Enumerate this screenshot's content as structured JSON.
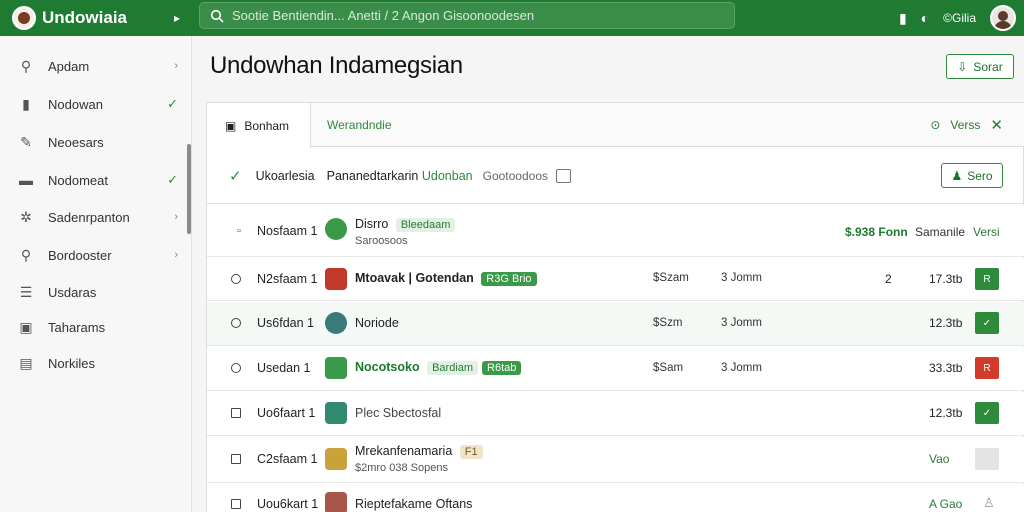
{
  "app": {
    "name": "Undowiaia"
  },
  "search": {
    "placeholder": "Sootie Bentiendin... Anetti / 2 Angon Gisoonoodesen"
  },
  "topbar": {
    "user": "©Gilia"
  },
  "sidebar": {
    "items": [
      {
        "label": "Apdam",
        "icon": "search-icon",
        "trail": "›"
      },
      {
        "label": "Nodowan",
        "icon": "bag-icon",
        "trail": "✓"
      },
      {
        "label": "Neoesars",
        "icon": "pencil-icon",
        "trail": ""
      },
      {
        "label": "Nodomeat",
        "icon": "folder-icon",
        "trail": "✓"
      },
      {
        "label": "Sadenrpanton",
        "icon": "gear-icon",
        "trail": "›"
      },
      {
        "label": "Bordooster",
        "icon": "search-icon",
        "trail": "›"
      },
      {
        "label": "Usdaras",
        "icon": "list-icon",
        "trail": ""
      },
      {
        "label": "Taharams",
        "icon": "image-icon",
        "trail": ""
      },
      {
        "label": "Norkiles",
        "icon": "doc-icon",
        "trail": ""
      }
    ]
  },
  "main": {
    "title": "Undowhan Indamegsian",
    "top_button": "Sorar"
  },
  "tabs": {
    "active": "Bonham",
    "second": "Werandndie",
    "right_label": "Verss"
  },
  "filterbar": {
    "t1": "Ukoarlesia",
    "t2a": "Pananedtarkarin",
    "t2b": "Udonban",
    "t3": "Gootoodoos",
    "button": "Sero"
  },
  "header_row": {
    "name": "Nosfaam 1",
    "title": "Disrro",
    "pill": "Bleedaam",
    "sub": "Saroosoos",
    "price": "$.938 Fonn",
    "col_a": "Samanile",
    "col_b": "Versi"
  },
  "rows": [
    {
      "name": "N2sfaam 1",
      "title": "Mtoavak | Gotendan",
      "pill": "R3G Brio",
      "c1": "$Szam",
      "c2": "3 Jomm",
      "c3": "2",
      "c4": "17.3tb",
      "action": "R",
      "thumb_color": "#c0392b",
      "select": "radio",
      "action_color": "#2e8b3c"
    },
    {
      "name": "Us6fdan 1",
      "title": "Noriode",
      "pill": "",
      "c1": "$Szm",
      "c2": "3 Jomm",
      "c3": "",
      "c4": "12.3tb",
      "action": "✓",
      "thumb_color": "#3a7a7a",
      "select": "radio",
      "action_color": "#2e8b3c"
    },
    {
      "name": "Usedan 1",
      "title": "Nocotsoko",
      "pill": "Bardiam",
      "pill2": "R6tab",
      "c1": "$Sam",
      "c2": "3 Jomm",
      "c3": "",
      "c4": "33.3tb",
      "action": "R",
      "thumb_color": "#3a9a47",
      "select": "radio",
      "action_color": "#d23a2a"
    },
    {
      "name": "Uo6faart 1",
      "title": "Plec Sbectosfal",
      "pill": "",
      "c1": "",
      "c2": "",
      "c3": "",
      "c4": "12.3tb",
      "action": "✓",
      "thumb_color": "#2f8a70",
      "select": "box",
      "action_color": "#2e8b3c"
    },
    {
      "name": "C2sfaam 1",
      "title": "Mrekanfenamaria",
      "pill": "F1",
      "sub": "$2mro 038 Sopens",
      "c1": "",
      "c2": "",
      "c3": "",
      "c4": "Vao",
      "action": "",
      "thumb_color": "#c9a23a",
      "select": "box",
      "action_color": "#e4e4e4"
    },
    {
      "name": "Uou6kart 1",
      "title": "Rieptefakame Oftans",
      "pill": "",
      "c1": "",
      "c2": "",
      "c3": "",
      "c4": "A Gao",
      "action": "",
      "thumb_color": "#a8564a",
      "select": "box",
      "action_color": "#ffffff"
    }
  ],
  "colors": {
    "brand": "#1f7a32",
    "accent": "#2e8b3c",
    "danger": "#d23a2a"
  }
}
